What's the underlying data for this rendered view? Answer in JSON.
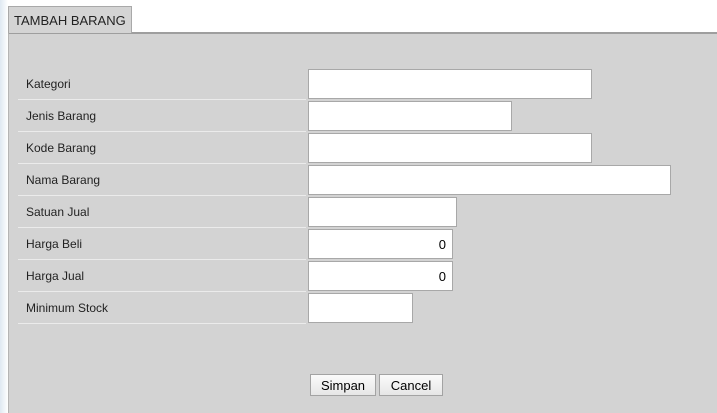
{
  "tab": {
    "label": "TAMBAH BARANG"
  },
  "form": {
    "fields": [
      {
        "label": "Kategori",
        "value": ""
      },
      {
        "label": "Jenis Barang",
        "value": ""
      },
      {
        "label": "Kode Barang",
        "value": ""
      },
      {
        "label": "Nama Barang",
        "value": ""
      },
      {
        "label": "Satuan Jual",
        "value": ""
      },
      {
        "label": "Harga Beli",
        "value": "0"
      },
      {
        "label": "Harga Jual",
        "value": "0"
      },
      {
        "label": "Minimum Stock",
        "value": ""
      }
    ]
  },
  "buttons": {
    "save": "Simpan",
    "cancel": "Cancel"
  }
}
